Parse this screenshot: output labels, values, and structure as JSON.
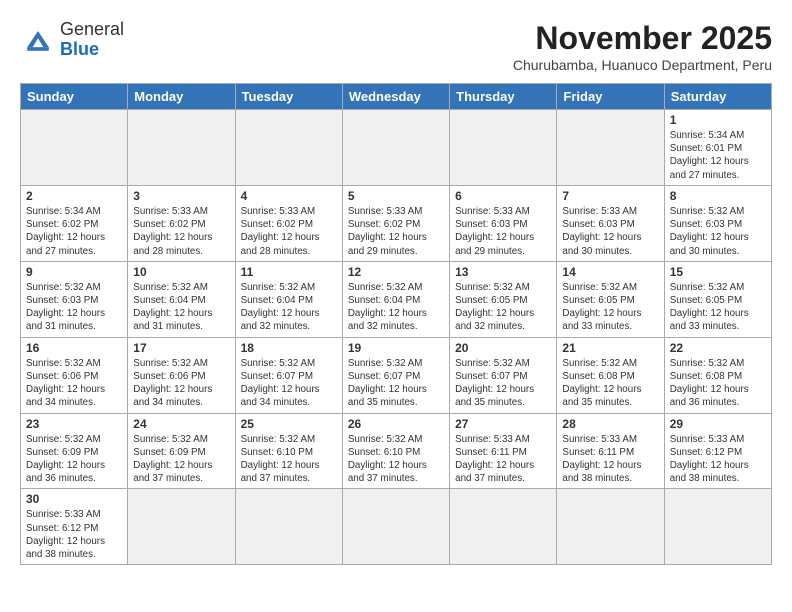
{
  "header": {
    "logo": {
      "line1": "General",
      "line2": "Blue"
    },
    "title": "November 2025",
    "subtitle": "Churubamba, Huanuco Department, Peru"
  },
  "weekdays": [
    "Sunday",
    "Monday",
    "Tuesday",
    "Wednesday",
    "Thursday",
    "Friday",
    "Saturday"
  ],
  "weeks": [
    [
      {
        "day": null
      },
      {
        "day": null
      },
      {
        "day": null
      },
      {
        "day": null
      },
      {
        "day": null
      },
      {
        "day": null
      },
      {
        "day": 1,
        "sunrise": "5:34 AM",
        "sunset": "6:01 PM",
        "daylight": "12 hours and 27 minutes."
      }
    ],
    [
      {
        "day": 2,
        "sunrise": "5:34 AM",
        "sunset": "6:02 PM",
        "daylight": "12 hours and 27 minutes."
      },
      {
        "day": 3,
        "sunrise": "5:33 AM",
        "sunset": "6:02 PM",
        "daylight": "12 hours and 28 minutes."
      },
      {
        "day": 4,
        "sunrise": "5:33 AM",
        "sunset": "6:02 PM",
        "daylight": "12 hours and 28 minutes."
      },
      {
        "day": 5,
        "sunrise": "5:33 AM",
        "sunset": "6:02 PM",
        "daylight": "12 hours and 29 minutes."
      },
      {
        "day": 6,
        "sunrise": "5:33 AM",
        "sunset": "6:03 PM",
        "daylight": "12 hours and 29 minutes."
      },
      {
        "day": 7,
        "sunrise": "5:33 AM",
        "sunset": "6:03 PM",
        "daylight": "12 hours and 30 minutes."
      },
      {
        "day": 8,
        "sunrise": "5:32 AM",
        "sunset": "6:03 PM",
        "daylight": "12 hours and 30 minutes."
      }
    ],
    [
      {
        "day": 9,
        "sunrise": "5:32 AM",
        "sunset": "6:03 PM",
        "daylight": "12 hours and 31 minutes."
      },
      {
        "day": 10,
        "sunrise": "5:32 AM",
        "sunset": "6:04 PM",
        "daylight": "12 hours and 31 minutes."
      },
      {
        "day": 11,
        "sunrise": "5:32 AM",
        "sunset": "6:04 PM",
        "daylight": "12 hours and 32 minutes."
      },
      {
        "day": 12,
        "sunrise": "5:32 AM",
        "sunset": "6:04 PM",
        "daylight": "12 hours and 32 minutes."
      },
      {
        "day": 13,
        "sunrise": "5:32 AM",
        "sunset": "6:05 PM",
        "daylight": "12 hours and 32 minutes."
      },
      {
        "day": 14,
        "sunrise": "5:32 AM",
        "sunset": "6:05 PM",
        "daylight": "12 hours and 33 minutes."
      },
      {
        "day": 15,
        "sunrise": "5:32 AM",
        "sunset": "6:05 PM",
        "daylight": "12 hours and 33 minutes."
      }
    ],
    [
      {
        "day": 16,
        "sunrise": "5:32 AM",
        "sunset": "6:06 PM",
        "daylight": "12 hours and 34 minutes."
      },
      {
        "day": 17,
        "sunrise": "5:32 AM",
        "sunset": "6:06 PM",
        "daylight": "12 hours and 34 minutes."
      },
      {
        "day": 18,
        "sunrise": "5:32 AM",
        "sunset": "6:07 PM",
        "daylight": "12 hours and 34 minutes."
      },
      {
        "day": 19,
        "sunrise": "5:32 AM",
        "sunset": "6:07 PM",
        "daylight": "12 hours and 35 minutes."
      },
      {
        "day": 20,
        "sunrise": "5:32 AM",
        "sunset": "6:07 PM",
        "daylight": "12 hours and 35 minutes."
      },
      {
        "day": 21,
        "sunrise": "5:32 AM",
        "sunset": "6:08 PM",
        "daylight": "12 hours and 35 minutes."
      },
      {
        "day": 22,
        "sunrise": "5:32 AM",
        "sunset": "6:08 PM",
        "daylight": "12 hours and 36 minutes."
      }
    ],
    [
      {
        "day": 23,
        "sunrise": "5:32 AM",
        "sunset": "6:09 PM",
        "daylight": "12 hours and 36 minutes."
      },
      {
        "day": 24,
        "sunrise": "5:32 AM",
        "sunset": "6:09 PM",
        "daylight": "12 hours and 37 minutes."
      },
      {
        "day": 25,
        "sunrise": "5:32 AM",
        "sunset": "6:10 PM",
        "daylight": "12 hours and 37 minutes."
      },
      {
        "day": 26,
        "sunrise": "5:32 AM",
        "sunset": "6:10 PM",
        "daylight": "12 hours and 37 minutes."
      },
      {
        "day": 27,
        "sunrise": "5:33 AM",
        "sunset": "6:11 PM",
        "daylight": "12 hours and 37 minutes."
      },
      {
        "day": 28,
        "sunrise": "5:33 AM",
        "sunset": "6:11 PM",
        "daylight": "12 hours and 38 minutes."
      },
      {
        "day": 29,
        "sunrise": "5:33 AM",
        "sunset": "6:12 PM",
        "daylight": "12 hours and 38 minutes."
      }
    ],
    [
      {
        "day": 30,
        "sunrise": "5:33 AM",
        "sunset": "6:12 PM",
        "daylight": "12 hours and 38 minutes."
      },
      {
        "day": null
      },
      {
        "day": null
      },
      {
        "day": null
      },
      {
        "day": null
      },
      {
        "day": null
      },
      {
        "day": null
      }
    ]
  ],
  "labels": {
    "sunrise": "Sunrise:",
    "sunset": "Sunset:",
    "daylight": "Daylight:"
  }
}
